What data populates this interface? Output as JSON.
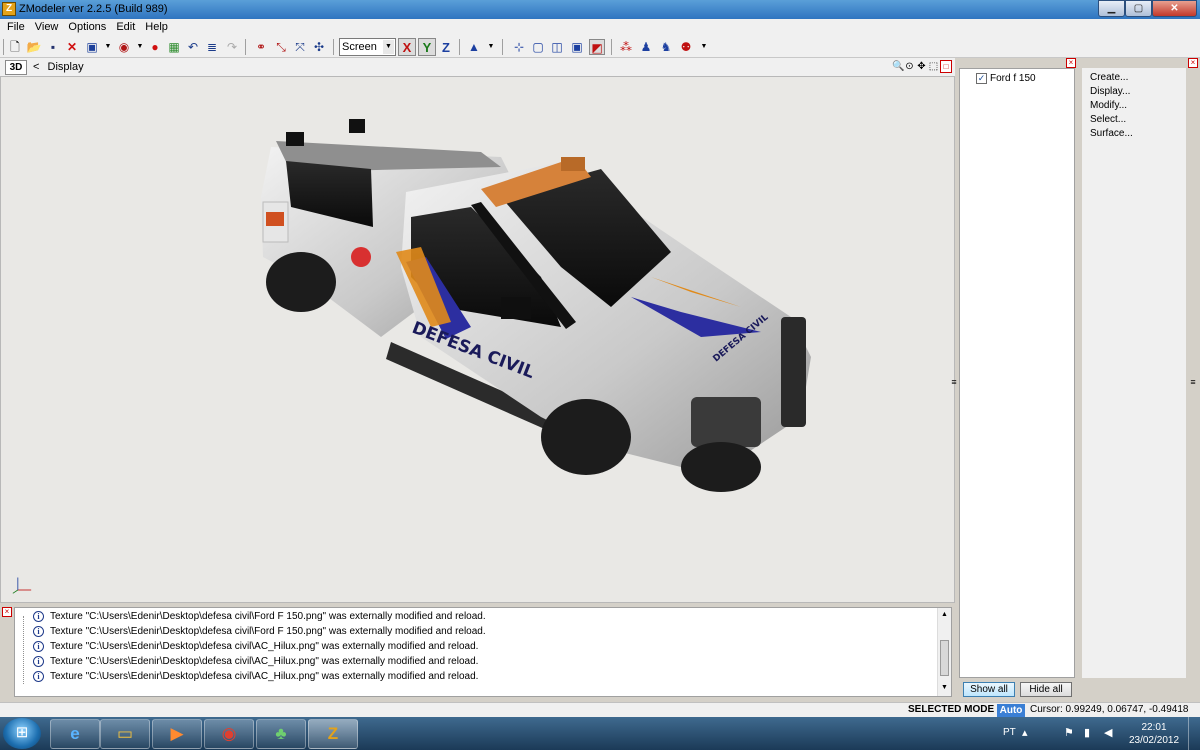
{
  "window": {
    "title": "ZModeler ver 2.2.5 (Build 989)",
    "app_icon": "Z",
    "minimize": "▁",
    "maximize": "▢",
    "close": "✕"
  },
  "menu": [
    "File",
    "View",
    "Options",
    "Edit",
    "Help"
  ],
  "toolbar": {
    "view_select": "Screen",
    "axes": [
      "X",
      "Y",
      "Z"
    ]
  },
  "viewport": {
    "mode": "3D",
    "nav_back": "<",
    "title": "Display",
    "model_text": "DEFESA CIVIL"
  },
  "scene_tree": {
    "item": "Ford f 150",
    "checked": "✓",
    "show_all": "Show all",
    "hide_all": "Hide all"
  },
  "commands": [
    "Create...",
    "Display...",
    "Modify...",
    "Select...",
    "Surface..."
  ],
  "log": [
    "Texture \"C:\\Users\\Edenir\\Desktop\\defesa civil\\Ford F 150.png\" was externally modified and reload.",
    "Texture \"C:\\Users\\Edenir\\Desktop\\defesa civil\\Ford F 150.png\" was externally modified and reload.",
    "Texture \"C:\\Users\\Edenir\\Desktop\\defesa civil\\AC_Hilux.png\" was externally modified and reload.",
    "Texture \"C:\\Users\\Edenir\\Desktop\\defesa civil\\AC_Hilux.png\" was externally modified and reload.",
    "Texture \"C:\\Users\\Edenir\\Desktop\\defesa civil\\AC_Hilux.png\" was externally modified and reload."
  ],
  "status": {
    "mode": "SELECTED MODE",
    "auto": "Auto",
    "cursor": "Cursor: 0.99249, 0.06747, -0.49418"
  },
  "tray": {
    "language": "PT",
    "time": "22:01",
    "date": "23/02/2012"
  },
  "taskbar_icons": [
    "ie-icon",
    "explorer-icon",
    "media-player-icon",
    "chrome-icon",
    "messenger-icon",
    "zmodeler-icon"
  ]
}
